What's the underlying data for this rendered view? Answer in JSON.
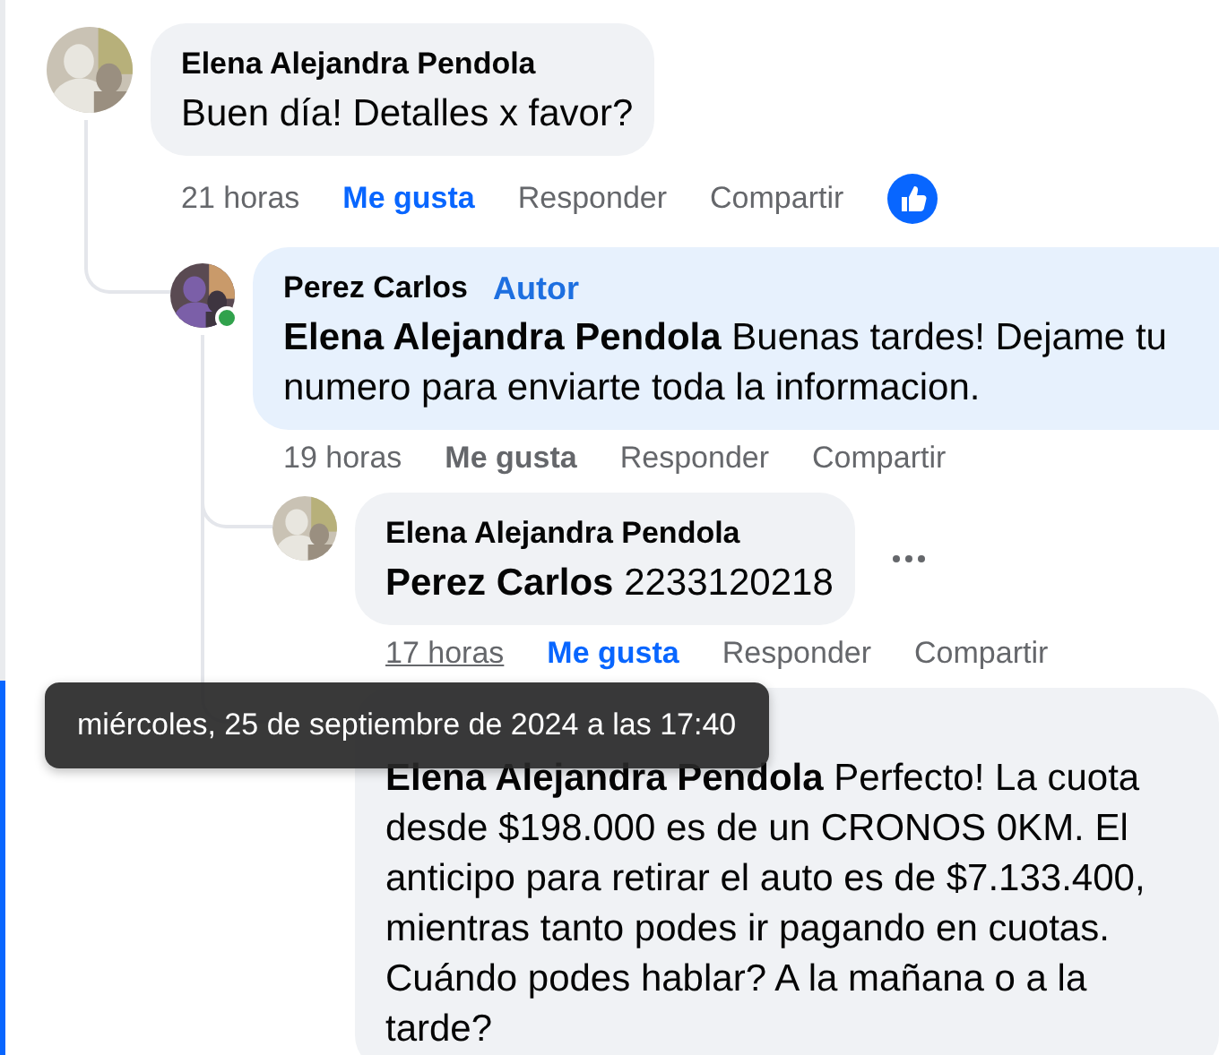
{
  "comments": [
    {
      "author": "Elena Alejandra Pendola",
      "text": "Buen día! Detalles x favor?",
      "time": "21 horas",
      "time_hovered": false,
      "like_label": "Me gusta",
      "reply_label": "Responder",
      "share_label": "Compartir",
      "liked": true,
      "has_reaction": true,
      "author_reply": false,
      "children": [
        {
          "author": "Perez Carlos",
          "badge": "Autor",
          "mention": "Elena Alejandra Pendola",
          "text": "Buenas tardes! Dejame tu numero para enviarte toda la informacion.",
          "time": "19 horas",
          "time_hovered": false,
          "like_label": "Me gusta",
          "reply_label": "Responder",
          "share_label": "Compartir",
          "liked": false,
          "online": true,
          "author_reply": true,
          "children": [
            {
              "author": "Elena Alejandra Pendola",
              "mention": "Perez Carlos",
              "text": "2233120218",
              "time": "17 horas",
              "time_hovered": true,
              "like_label": "Me gusta",
              "reply_label": "Responder",
              "share_label": "Compartir",
              "liked": true,
              "author_reply": false,
              "more_menu": true
            },
            {
              "mention": "Elena Alejandra Pendola",
              "text": "Perfecto! La cuota desde $198.000 es de un CRONOS 0KM. El anticipo para retirar el auto es de $7.133.400, mientras tanto podes ir pagando en cuotas. Cuándo podes hablar? A la mañana o a la tarde?",
              "author_reply": false,
              "highlighted": true
            }
          ]
        }
      ]
    }
  ],
  "tooltip": "miércoles, 25 de septiembre de 2024 a las 17:40"
}
